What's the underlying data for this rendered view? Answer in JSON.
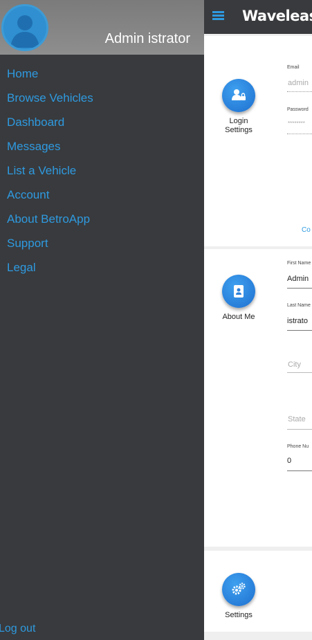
{
  "drawer": {
    "user_name": "Admin istrator",
    "menu": [
      {
        "label": "Home"
      },
      {
        "label": "Browse Vehicles"
      },
      {
        "label": "Dashboard"
      },
      {
        "label": "Messages"
      },
      {
        "label": "List a Vehicle"
      },
      {
        "label": "Account"
      },
      {
        "label": "About BetroApp"
      },
      {
        "label": "Support"
      },
      {
        "label": "Legal"
      }
    ],
    "logout": "Log out"
  },
  "topbar": {
    "brand": "Wavelease"
  },
  "login": {
    "label_line1": "Login",
    "label_line2": "Settings",
    "email_label": "Email",
    "email_value": "admin",
    "password_label": "Password",
    "password_value": "********",
    "continue_link": "Co"
  },
  "about": {
    "label": "About Me",
    "first_name_label": "First Name",
    "first_name_value": "Admin",
    "last_name_label": "Last Name",
    "last_name_value": "istrato",
    "city_placeholder": "City",
    "state_placeholder": "State",
    "phone_label": "Phone Nu",
    "phone_value": "0"
  },
  "settings": {
    "label": "Settings"
  },
  "colors": {
    "accent": "#2e9ae0",
    "drawer_bg": "#393a3d"
  }
}
